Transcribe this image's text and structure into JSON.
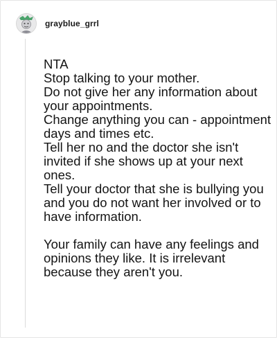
{
  "comment": {
    "author": "grayblue_grrl",
    "avatar_icon": "avatar-icon",
    "lines": [
      "NTA",
      "Stop talking to your mother.",
      "Do not give her any information about your appointments.",
      "Change anything you can - appointment days and times etc.",
      "Tell her no and the doctor she isn't invited if she shows up at your next ones.",
      "Tell your doctor that she is bullying you and you do not want her involved or to have information."
    ],
    "closing": "Your family can have any feelings and opinions they like. It is irrelevant because they aren't you."
  }
}
